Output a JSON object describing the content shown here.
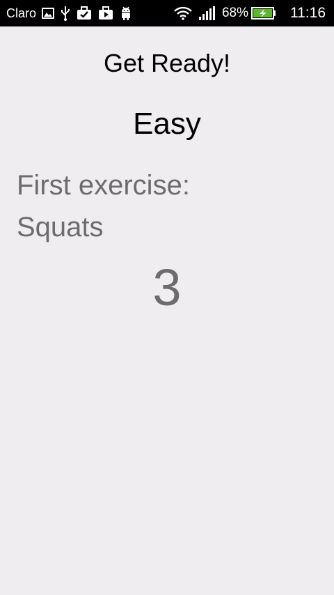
{
  "status_bar": {
    "carrier": "Claro",
    "battery_percent": "68%",
    "time": "11:16",
    "icons": [
      "image-icon",
      "usb-icon",
      "briefcase-check-icon",
      "play-store-icon",
      "android-icon",
      "wifi-icon",
      "signal-icon",
      "battery-charging-icon"
    ],
    "battery_color": "#5cb82e"
  },
  "screen": {
    "title": "Get Ready!",
    "difficulty": "Easy",
    "exercise_label": "First exercise:",
    "exercise_name": "Squats",
    "countdown": "3"
  },
  "colors": {
    "background": "#efedf0",
    "secondary_text": "#6d6b6e",
    "primary_text": "#000000"
  }
}
